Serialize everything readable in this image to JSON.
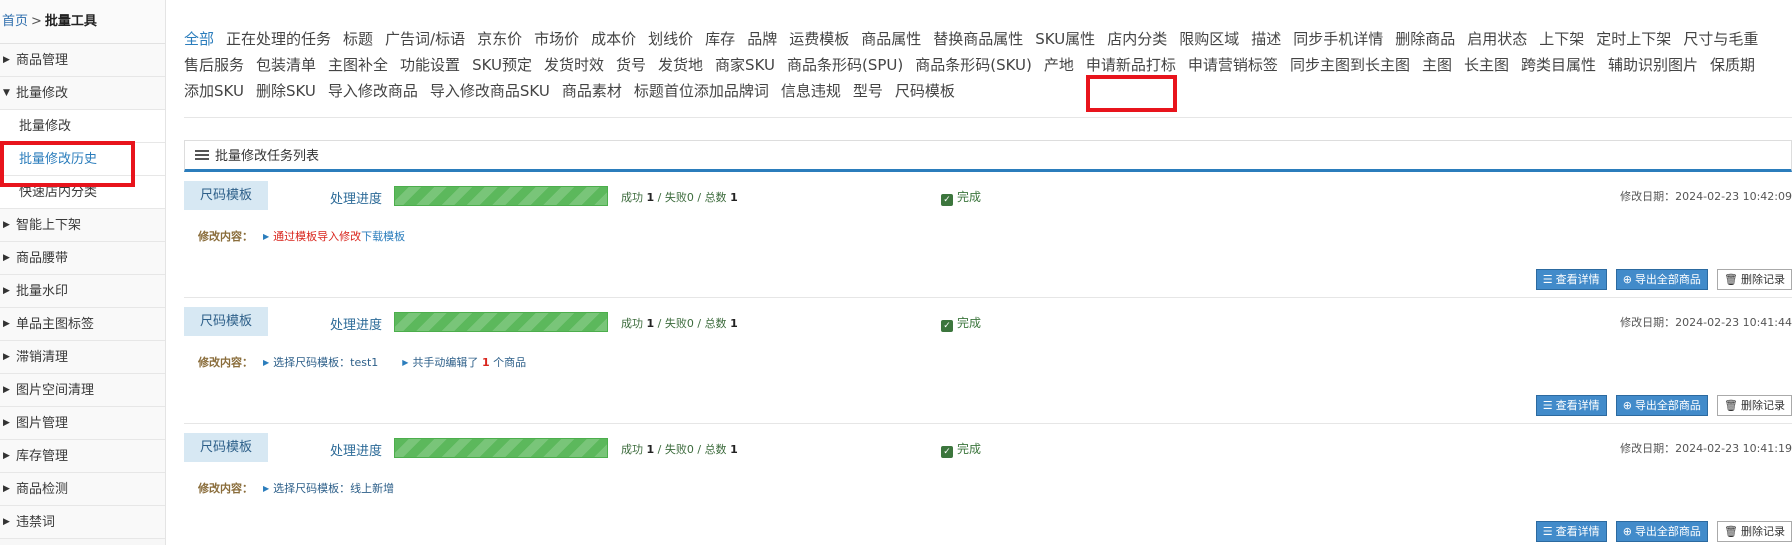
{
  "breadcrumb": {
    "home": "首页",
    "sep": ">",
    "current": "批量工具"
  },
  "sidebar": {
    "items": [
      {
        "label": "商品管理",
        "level": "top",
        "arrow": "▶"
      },
      {
        "label": "批量修改",
        "level": "top",
        "arrow": "▼"
      },
      {
        "label": "批量修改",
        "level": "sub"
      },
      {
        "label": "批量修改历史",
        "level": "sub",
        "active": true
      },
      {
        "label": "快速店内分类",
        "level": "sub"
      },
      {
        "label": "智能上下架",
        "level": "top",
        "arrow": "▶"
      },
      {
        "label": "商品腰带",
        "level": "top",
        "arrow": "▶"
      },
      {
        "label": "批量水印",
        "level": "top",
        "arrow": "▶"
      },
      {
        "label": "单品主图标签",
        "level": "top",
        "arrow": "▶"
      },
      {
        "label": "滞销清理",
        "level": "top",
        "arrow": "▶"
      },
      {
        "label": "图片空间清理",
        "level": "top",
        "arrow": "▶"
      },
      {
        "label": "图片管理",
        "level": "top",
        "arrow": "▶"
      },
      {
        "label": "库存管理",
        "level": "top",
        "arrow": "▶"
      },
      {
        "label": "商品检测",
        "level": "top",
        "arrow": "▶"
      },
      {
        "label": "违禁词",
        "level": "top",
        "arrow": "▶"
      }
    ]
  },
  "tabs": {
    "items": [
      "全部",
      "正在处理的任务",
      "标题",
      "广告词/标语",
      "京东价",
      "市场价",
      "成本价",
      "划线价",
      "库存",
      "品牌",
      "运费模板",
      "商品属性",
      "替换商品属性",
      "SKU属性",
      "店内分类",
      "限购区域",
      "描述",
      "同步手机详情",
      "删除商品",
      "启用状态",
      "上下架",
      "定时上下架",
      "尺寸与毛重",
      "售后服务",
      "包装清单",
      "主图补全",
      "功能设置",
      "SKU预定",
      "发货时效",
      "货号",
      "发货地",
      "商家SKU",
      "商品条形码(SPU)",
      "商品条形码(SKU)",
      "产地",
      "申请新品打标",
      "申请营销标签",
      "同步主图到长主图",
      "主图",
      "长主图",
      "跨类目属性",
      "辅助识别图片",
      "保质期",
      "添加SKU",
      "删除SKU",
      "导入修改商品",
      "导入修改商品SKU",
      "商品素材",
      "标题首位添加品牌词",
      "信息违规",
      "型号",
      "尺码模板"
    ],
    "active_index": 0
  },
  "panel": {
    "title": "批量修改任务列表",
    "icon": "list-icon"
  },
  "tasks": [
    {
      "tag": "尺码模板",
      "progress_label": "处理进度",
      "progress": 1.0,
      "success_label": "成功",
      "success": "1",
      "fail_label": "/ 失败0 /",
      "total_label": "总数",
      "total": "1",
      "status": "完成",
      "date": "修改日期：2024-02-23 10:42:09",
      "content_label": "修改内容：",
      "content": {
        "red": "通过模板导入修改",
        "link": "下载模板"
      }
    },
    {
      "tag": "尺码模板",
      "progress_label": "处理进度",
      "progress": 1.0,
      "success_label": "成功",
      "success": "1",
      "fail_label": "/ 失败0 /",
      "total_label": "总数",
      "total": "1",
      "status": "完成",
      "date": "修改日期：2024-02-23 10:41:44",
      "content_label": "修改内容：",
      "content": {
        "plain": "选择尺码模板：test1",
        "plain2a": "共手动编辑了",
        "count": "1",
        "plain2b": "个商品"
      }
    },
    {
      "tag": "尺码模板",
      "progress_label": "处理进度",
      "progress": 1.0,
      "success_label": "成功",
      "success": "1",
      "fail_label": "/ 失败0 /",
      "total_label": "总数",
      "total": "1",
      "status": "完成",
      "date": "修改日期：2024-02-23 10:41:19",
      "content_label": "修改内容：",
      "content": {
        "plain": "选择尺码模板：线上新增"
      }
    }
  ],
  "buttons": {
    "detail": "查看详情",
    "export": "导出全部商品",
    "delete": "删除记录"
  },
  "colors": {
    "accent": "#2b7dbc",
    "highlight": "#e8141c",
    "progress": "#5cb85c"
  }
}
